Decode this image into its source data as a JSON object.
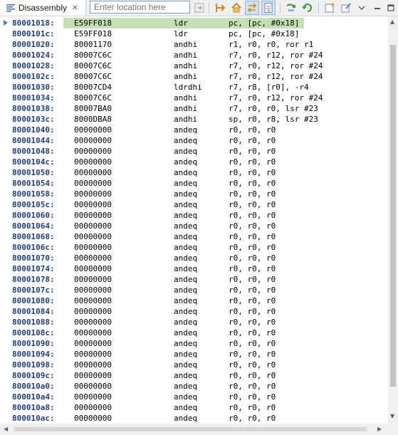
{
  "tab": {
    "title": "Disassembly",
    "close_glyph": "✕"
  },
  "location": {
    "placeholder": "Enter location here",
    "value": ""
  },
  "toolbar_icons": [
    "go-to-location-icon",
    "home-icon",
    "link-with-pc-icon",
    "show-source-icon",
    "step-into-icon",
    "refresh-icon",
    "new-view-icon",
    "open-file-icon"
  ],
  "listing": {
    "current_index": 0,
    "rows": [
      {
        "addr": "80001018:",
        "opcode": "E59FF018",
        "mnemonic": "ldr",
        "operands": "pc, [pc, #0x18]"
      },
      {
        "addr": "8000101c:",
        "opcode": "E59FF018",
        "mnemonic": "ldr",
        "operands": "pc, [pc, #0x18]"
      },
      {
        "addr": "80001020:",
        "opcode": "80001170",
        "mnemonic": "andhi",
        "operands": "r1, r0, r0, ror r1"
      },
      {
        "addr": "80001024:",
        "opcode": "80007C6C",
        "mnemonic": "andhi",
        "operands": "r7, r0, r12, ror #24"
      },
      {
        "addr": "80001028:",
        "opcode": "80007C6C",
        "mnemonic": "andhi",
        "operands": "r7, r0, r12, ror #24"
      },
      {
        "addr": "8000102c:",
        "opcode": "80007C6C",
        "mnemonic": "andhi",
        "operands": "r7, r0, r12, ror #24"
      },
      {
        "addr": "80001030:",
        "opcode": "80007CD4",
        "mnemonic": "ldrdhi",
        "operands": "r7, r8, [r0], -r4"
      },
      {
        "addr": "80001034:",
        "opcode": "80007C6C",
        "mnemonic": "andhi",
        "operands": "r7, r0, r12, ror #24"
      },
      {
        "addr": "80001038:",
        "opcode": "80007BA0",
        "mnemonic": "andhi",
        "operands": "r7, r0, r0, lsr #23"
      },
      {
        "addr": "8000103c:",
        "opcode": "8000DBA8",
        "mnemonic": "andhi",
        "operands": "sp, r0, r8, lsr #23"
      },
      {
        "addr": "80001040:",
        "opcode": "00000000",
        "mnemonic": "andeq",
        "operands": "r0, r0, r0"
      },
      {
        "addr": "80001044:",
        "opcode": "00000000",
        "mnemonic": "andeq",
        "operands": "r0, r0, r0"
      },
      {
        "addr": "80001048:",
        "opcode": "00000000",
        "mnemonic": "andeq",
        "operands": "r0, r0, r0"
      },
      {
        "addr": "8000104c:",
        "opcode": "00000000",
        "mnemonic": "andeq",
        "operands": "r0, r0, r0"
      },
      {
        "addr": "80001050:",
        "opcode": "00000000",
        "mnemonic": "andeq",
        "operands": "r0, r0, r0"
      },
      {
        "addr": "80001054:",
        "opcode": "00000000",
        "mnemonic": "andeq",
        "operands": "r0, r0, r0"
      },
      {
        "addr": "80001058:",
        "opcode": "00000000",
        "mnemonic": "andeq",
        "operands": "r0, r0, r0"
      },
      {
        "addr": "8000105c:",
        "opcode": "00000000",
        "mnemonic": "andeq",
        "operands": "r0, r0, r0"
      },
      {
        "addr": "80001060:",
        "opcode": "00000000",
        "mnemonic": "andeq",
        "operands": "r0, r0, r0"
      },
      {
        "addr": "80001064:",
        "opcode": "00000000",
        "mnemonic": "andeq",
        "operands": "r0, r0, r0"
      },
      {
        "addr": "80001068:",
        "opcode": "00000000",
        "mnemonic": "andeq",
        "operands": "r0, r0, r0"
      },
      {
        "addr": "8000106c:",
        "opcode": "00000000",
        "mnemonic": "andeq",
        "operands": "r0, r0, r0"
      },
      {
        "addr": "80001070:",
        "opcode": "00000000",
        "mnemonic": "andeq",
        "operands": "r0, r0, r0"
      },
      {
        "addr": "80001074:",
        "opcode": "00000000",
        "mnemonic": "andeq",
        "operands": "r0, r0, r0"
      },
      {
        "addr": "80001078:",
        "opcode": "00000000",
        "mnemonic": "andeq",
        "operands": "r0, r0, r0"
      },
      {
        "addr": "8000107c:",
        "opcode": "00000000",
        "mnemonic": "andeq",
        "operands": "r0, r0, r0"
      },
      {
        "addr": "80001080:",
        "opcode": "00000000",
        "mnemonic": "andeq",
        "operands": "r0, r0, r0"
      },
      {
        "addr": "80001084:",
        "opcode": "00000000",
        "mnemonic": "andeq",
        "operands": "r0, r0, r0"
      },
      {
        "addr": "80001088:",
        "opcode": "00000000",
        "mnemonic": "andeq",
        "operands": "r0, r0, r0"
      },
      {
        "addr": "8000108c:",
        "opcode": "00000000",
        "mnemonic": "andeq",
        "operands": "r0, r0, r0"
      },
      {
        "addr": "80001090:",
        "opcode": "00000000",
        "mnemonic": "andeq",
        "operands": "r0, r0, r0"
      },
      {
        "addr": "80001094:",
        "opcode": "00000000",
        "mnemonic": "andeq",
        "operands": "r0, r0, r0"
      },
      {
        "addr": "80001098:",
        "opcode": "00000000",
        "mnemonic": "andeq",
        "operands": "r0, r0, r0"
      },
      {
        "addr": "8000109c:",
        "opcode": "00000000",
        "mnemonic": "andeq",
        "operands": "r0, r0, r0"
      },
      {
        "addr": "800010a0:",
        "opcode": "00000000",
        "mnemonic": "andeq",
        "operands": "r0, r0, r0"
      },
      {
        "addr": "800010a4:",
        "opcode": "00000000",
        "mnemonic": "andeq",
        "operands": "r0, r0, r0"
      },
      {
        "addr": "800010a8:",
        "opcode": "00000000",
        "mnemonic": "andeq",
        "operands": "r0, r0, r0"
      },
      {
        "addr": "800010ac:",
        "opcode": "00000000",
        "mnemonic": "andeq",
        "operands": "r0, r0, r0"
      }
    ]
  },
  "colors": {
    "address": "#1e3f88",
    "current_line_highlight": "#c5e0b4",
    "pc_marker": "#3b7fd1"
  }
}
